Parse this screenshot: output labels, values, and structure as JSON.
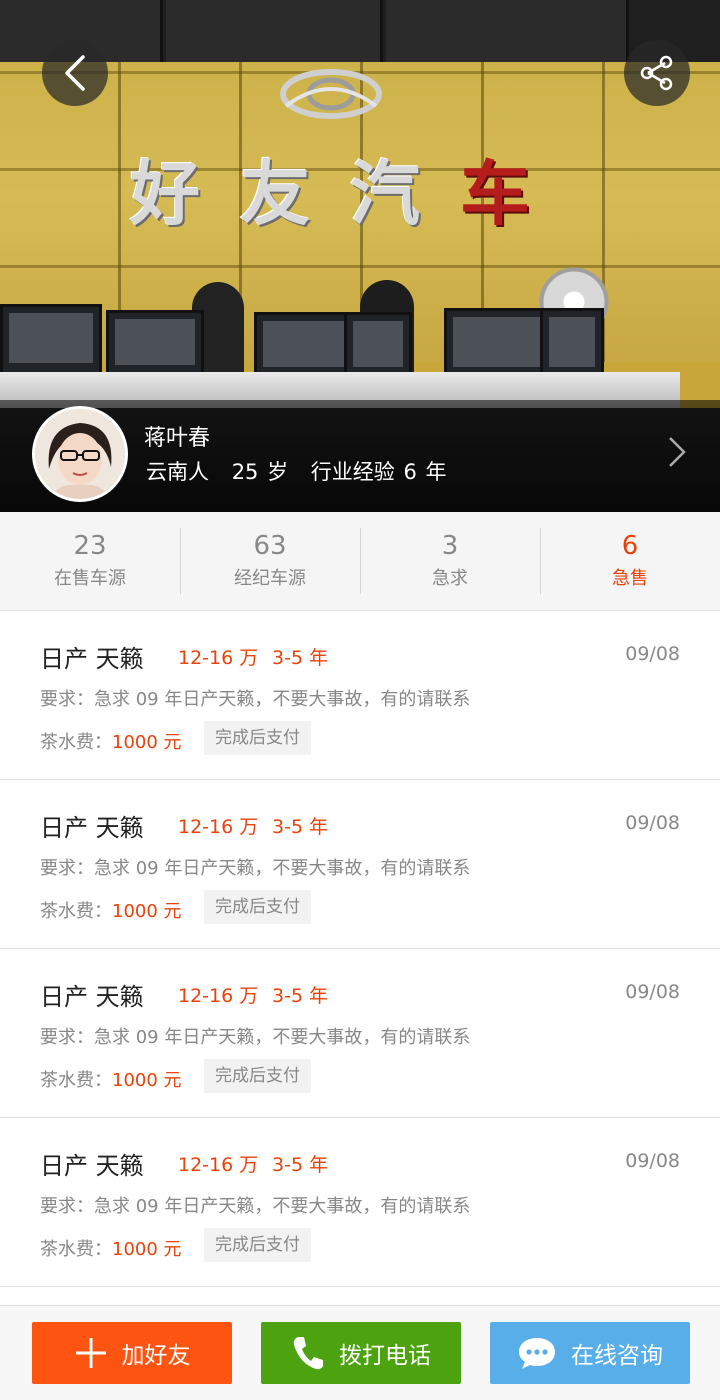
{
  "hero": {
    "sign_text": "好友汽",
    "sign_text_red": "车"
  },
  "nav": {
    "back_icon": "chevron-left-icon",
    "share_icon": "share-icon"
  },
  "profile": {
    "name": "蒋叶春",
    "origin": "云南人",
    "age": "25 岁",
    "experience": "行业经验 6 年"
  },
  "stats": [
    {
      "num": "23",
      "label": "在售车源"
    },
    {
      "num": "63",
      "label": "经纪车源"
    },
    {
      "num": "3",
      "label": "急求"
    },
    {
      "num": "6",
      "label": "急售"
    }
  ],
  "listings": [
    {
      "title": "日产 天籁",
      "price": "12-16 万",
      "years": "3-5 年",
      "date": "09/08",
      "requirement": "要求：急求 09 年日产天籁，不要大事故，有的请联系",
      "fee_label": "茶水费：",
      "fee_value": "1000 元",
      "pay_tag": "完成后支付"
    },
    {
      "title": "日产 天籁",
      "price": "12-16 万",
      "years": "3-5 年",
      "date": "09/08",
      "requirement": "要求：急求 09 年日产天籁，不要大事故，有的请联系",
      "fee_label": "茶水费：",
      "fee_value": "1000 元",
      "pay_tag": "完成后支付"
    },
    {
      "title": "日产 天籁",
      "price": "12-16 万",
      "years": "3-5 年",
      "date": "09/08",
      "requirement": "要求：急求 09 年日产天籁，不要大事故，有的请联系",
      "fee_label": "茶水费：",
      "fee_value": "1000 元",
      "pay_tag": "完成后支付"
    },
    {
      "title": "日产 天籁",
      "price": "12-16 万",
      "years": "3-5 年",
      "date": "09/08",
      "requirement": "要求：急求 09 年日产天籁，不要大事故，有的请联系",
      "fee_label": "茶水费：",
      "fee_value": "1000 元",
      "pay_tag": "完成后支付"
    }
  ],
  "bottom_bar": {
    "add_friend": "加好友",
    "call": "拨打电话",
    "chat": "在线咨询"
  },
  "colors": {
    "accent_orange": "#e8430a",
    "add_button": "#fe5412",
    "call_button": "#4ca30f",
    "chat_button": "#58aee8"
  }
}
